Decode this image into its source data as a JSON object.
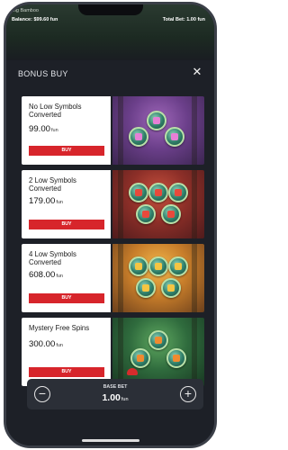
{
  "status": {
    "game_name": "Big Bamboo",
    "balance": "Balance: $99.60 fun",
    "total_bet": "Total Bet: 1.00 fun"
  },
  "modal": {
    "title": "BONUS BUY",
    "close_icon": "close-icon"
  },
  "offers": [
    {
      "name": "No Low Symbols Converted",
      "price": "99.00",
      "unit": "fun",
      "buy_label": "BUY",
      "art_color": "#7a4a9c",
      "coin_symbol_color": "#e77fd6"
    },
    {
      "name": "2 Low Symbols Converted",
      "price": "179.00",
      "unit": "fun",
      "buy_label": "BUY",
      "art_color": "#9a3a2c",
      "coin_symbol_color": "#e8493b"
    },
    {
      "name": "4 Low Symbols Converted",
      "price": "608.00",
      "unit": "fun",
      "buy_label": "BUY",
      "art_color": "#d08a30",
      "coin_symbol_color": "#f5c542"
    },
    {
      "name": "Mystery Free Spins",
      "price": "300.00",
      "unit": "fun",
      "buy_label": "BUY",
      "art_color": "#3c7a46",
      "coin_symbol_color": "#f08a2f"
    }
  ],
  "base_bet": {
    "label": "BASE BET",
    "value": "1.00",
    "unit": "fun",
    "decrease_icon": "minus-icon",
    "increase_icon": "plus-icon"
  },
  "colors": {
    "buy_button": "#d7252b",
    "modal_bg": "#1d2027",
    "card_bg": "#ffffff"
  }
}
